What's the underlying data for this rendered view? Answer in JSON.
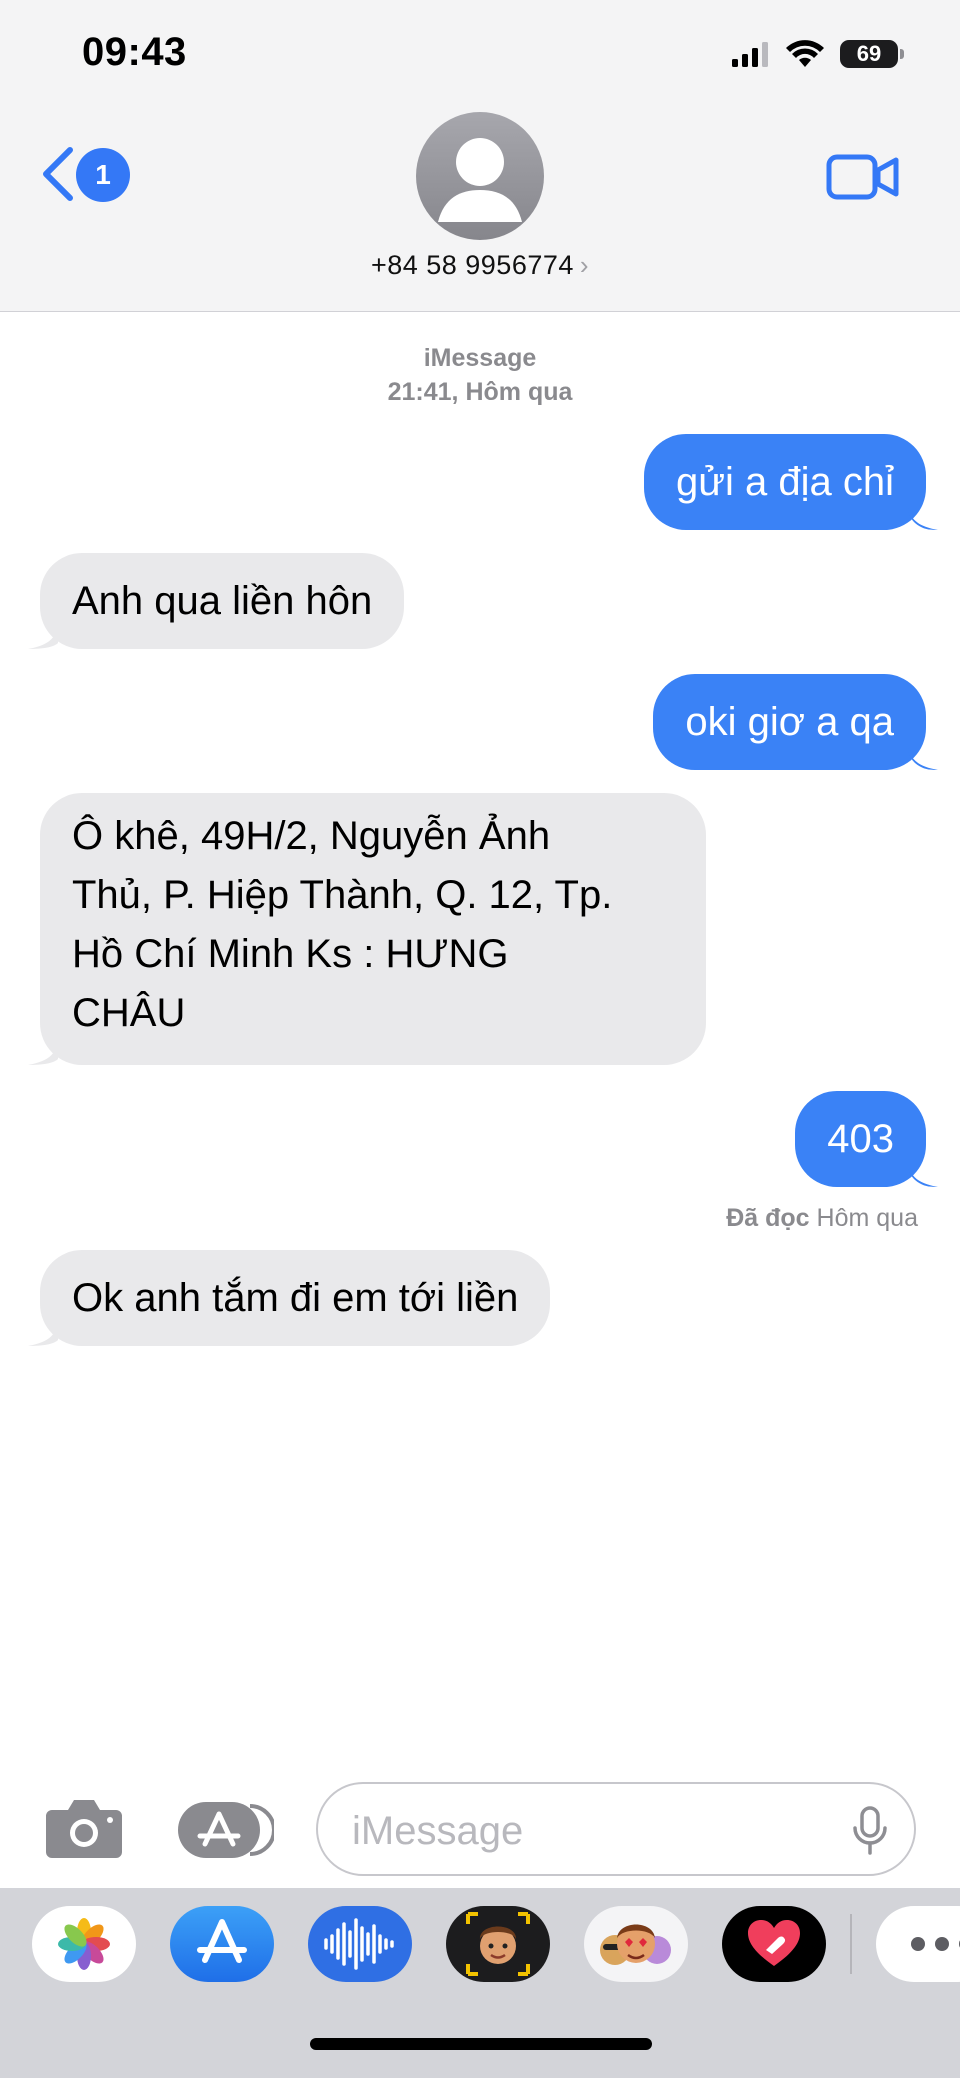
{
  "status_bar": {
    "time": "09:43",
    "battery": "69"
  },
  "header": {
    "back_badge": "1",
    "contact": "+84 58 9956774",
    "chevron": "›"
  },
  "conversation": {
    "service": "iMessage",
    "timestamp_time": "21:41,",
    "timestamp_day": "Hôm qua",
    "messages": [
      {
        "direction": "out",
        "text": "gửi a địa chỉ"
      },
      {
        "direction": "in",
        "text": "Anh qua liền hôn"
      },
      {
        "direction": "out",
        "text": "oki giơ a qa"
      },
      {
        "direction": "in",
        "lines": [
          "Ô khê,  49H/2, Nguyễn Ảnh",
          "Thủ, P. Hiệp Thành, Q. 12, Tp.",
          "Hồ Chí Minh  Ks :  HƯNG",
          "CHÂU"
        ]
      },
      {
        "direction": "out",
        "text": "403"
      },
      {
        "direction": "in",
        "text": "Ok anh tắm đi em tới liền"
      }
    ],
    "read_receipt": {
      "status": "Đã đọc",
      "time": "Hôm qua"
    }
  },
  "composer": {
    "placeholder": "iMessage",
    "value": ""
  },
  "app_drawer": {
    "apps": [
      "photos-app-icon",
      "app-store-icon",
      "audio-message-icon",
      "memoji-icon",
      "memoji-stickers-icon",
      "digital-touch-icon",
      "more-icon"
    ]
  },
  "colors": {
    "accent": "#3478f6",
    "bubble_out": "#3a82f6",
    "bubble_in": "#e9e9eb"
  }
}
